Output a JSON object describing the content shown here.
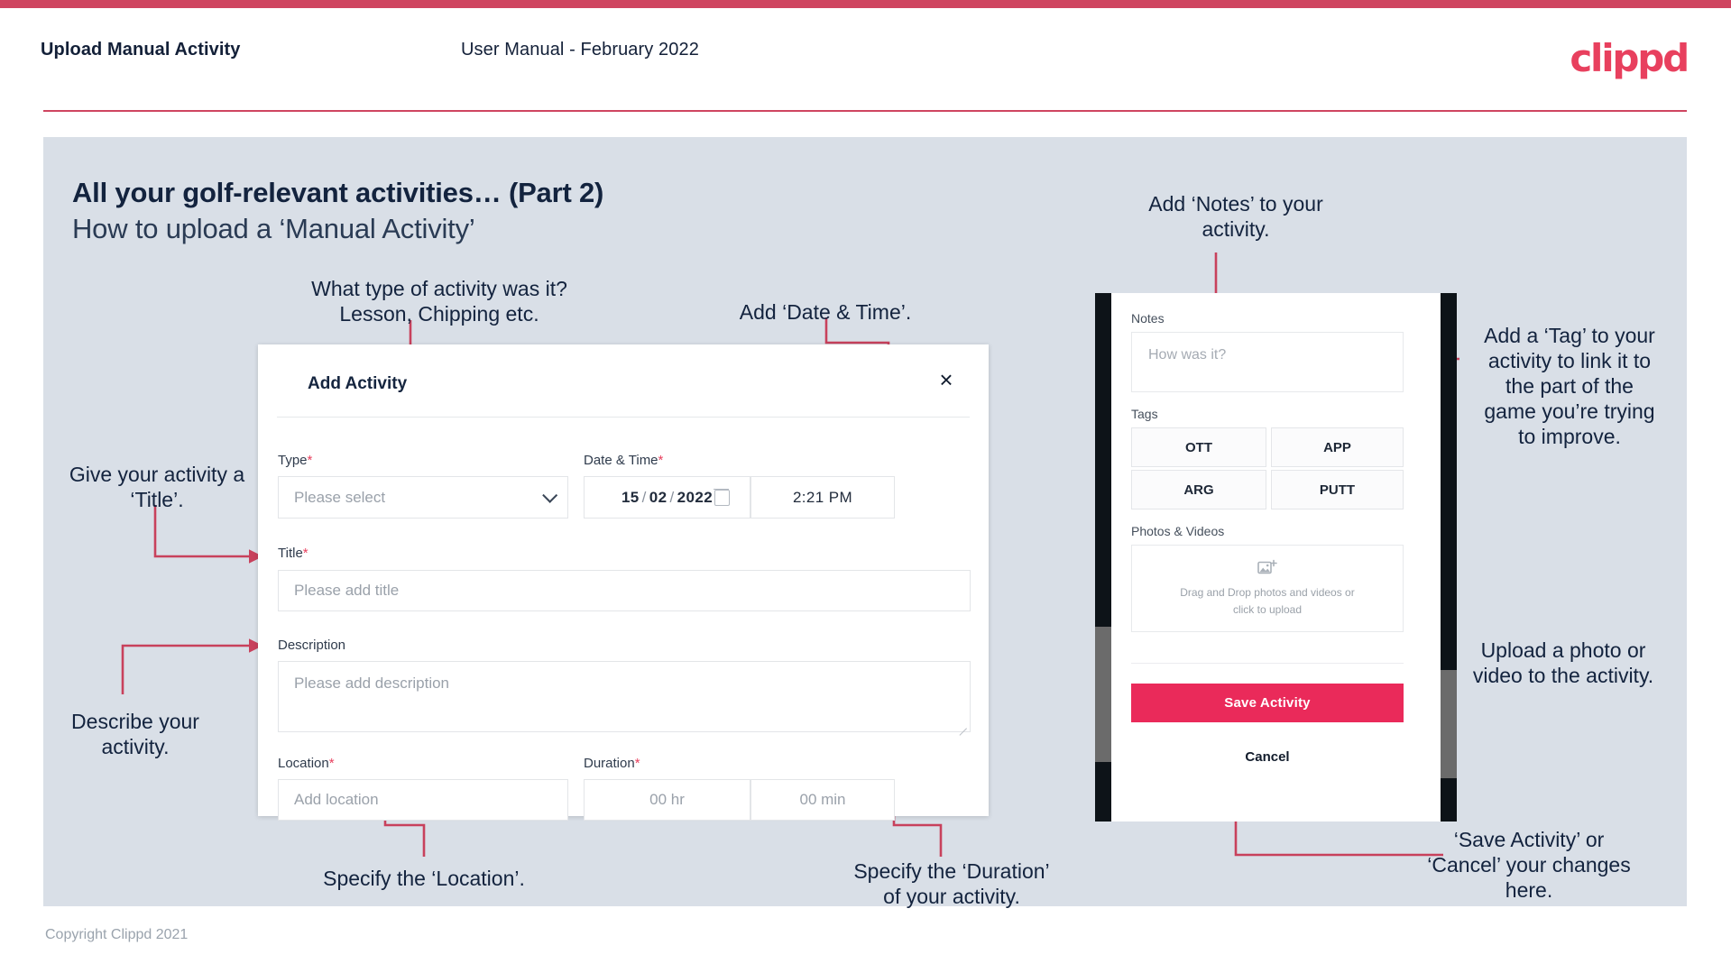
{
  "header": {
    "left_title": "Upload Manual Activity",
    "center_title": "User Manual - February 2022",
    "logo": "clippd"
  },
  "slide": {
    "title_line1": "All your golf-relevant activities… (Part 2)",
    "title_line2": "How to upload a ‘Manual Activity’",
    "footer": "Copyright Clippd 2021"
  },
  "colors": {
    "brand_pink": "#e8405e",
    "accent_bar": "#cf4560",
    "slide_bg": "#d9dfe7",
    "arrow": "#c8415c",
    "save_button": "#ea2a5a",
    "heading": "#13233e"
  },
  "annotations": [
    {
      "id": "type-note",
      "text": "What type of activity was it?\nLesson, Chipping etc."
    },
    {
      "id": "datetime-note",
      "text": "Add ‘Date & Time’."
    },
    {
      "id": "title-note",
      "text": "Give your activity a\n‘Title’."
    },
    {
      "id": "description-note",
      "text": "Describe your\nactivity."
    },
    {
      "id": "location-note",
      "text": "Specify the ‘Location’."
    },
    {
      "id": "duration-note",
      "text": "Specify the ‘Duration’\nof your activity."
    },
    {
      "id": "notes-note",
      "text": "Add ‘Notes’ to your\nactivity."
    },
    {
      "id": "tag-note",
      "text": "Add a ‘Tag’ to your\nactivity to link it to\nthe part of the\ngame you’re trying\nto improve."
    },
    {
      "id": "upload-note",
      "text": "Upload a photo or\nvideo to the activity."
    },
    {
      "id": "save-note",
      "text": "‘Save Activity’ or\n‘Cancel’ your changes\nhere."
    }
  ],
  "dialog": {
    "title": "Add Activity",
    "close_icon": "×",
    "type": {
      "label": "Type",
      "required_marker": "*",
      "placeholder": "Please select"
    },
    "datetime": {
      "label": "Date & Time",
      "required_marker": "*",
      "day": "15",
      "month": "02",
      "year": "2022",
      "separator": "/",
      "time": "2:21 PM"
    },
    "title_field": {
      "label": "Title",
      "required_marker": "*",
      "placeholder": "Please add title"
    },
    "description": {
      "label": "Description",
      "placeholder": "Please add description"
    },
    "location": {
      "label": "Location",
      "required_marker": "*",
      "placeholder": "Add location"
    },
    "duration": {
      "label": "Duration",
      "required_marker": "*",
      "hours_placeholder": "00 hr",
      "minutes_placeholder": "00 min"
    }
  },
  "phone": {
    "notes": {
      "label": "Notes",
      "placeholder": "How was it?"
    },
    "tags": {
      "label": "Tags",
      "items": [
        "OTT",
        "APP",
        "ARG",
        "PUTT"
      ]
    },
    "photos": {
      "label": "Photos & Videos",
      "dropzone_line1": "Drag and Drop photos and videos or",
      "dropzone_line2": "click to upload"
    },
    "save_label": "Save Activity",
    "cancel_label": "Cancel"
  }
}
